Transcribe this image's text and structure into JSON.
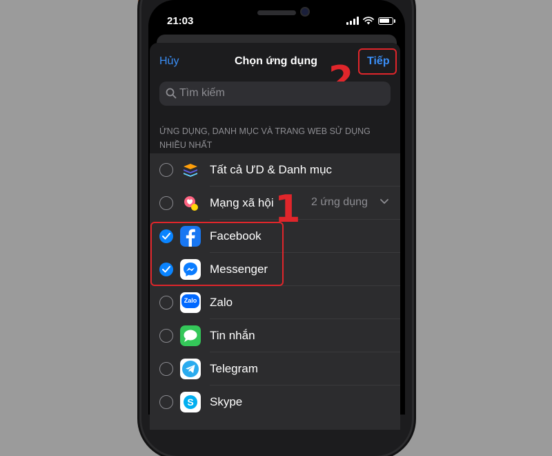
{
  "status_bar": {
    "time": "21:03"
  },
  "nav": {
    "cancel_label": "Hủy",
    "title": "Chọn ứng dụng",
    "next_label": "Tiếp"
  },
  "search": {
    "placeholder": "Tìm kiếm"
  },
  "section_header": "ỨNG DỤNG, DANH MỤC VÀ TRANG WEB SỬ DỤNG NHIỀU NHẤT",
  "rows": [
    {
      "label": "Tất cả ƯD & Danh mục",
      "selected": false,
      "icon": "stack-icon"
    },
    {
      "label": "Mạng xã hội",
      "detail": "2 ứng dụng",
      "selected": false,
      "icon": "social-icon"
    },
    {
      "label": "Facebook",
      "selected": true,
      "icon": "facebook-icon"
    },
    {
      "label": "Messenger",
      "selected": true,
      "icon": "messenger-icon"
    },
    {
      "label": "Zalo",
      "selected": false,
      "icon": "zalo-icon",
      "icon_text": "Zalo"
    },
    {
      "label": "Tin nhắn",
      "selected": false,
      "icon": "messages-icon"
    },
    {
      "label": "Telegram",
      "selected": false,
      "icon": "telegram-icon"
    },
    {
      "label": "Skype",
      "selected": false,
      "icon": "skype-icon"
    }
  ],
  "annotations": {
    "marker_1": "1",
    "marker_2": "2"
  },
  "colors": {
    "accent_blue": "#3a8ef6",
    "checkbox_blue": "#0a84ff",
    "annotation_red": "#e0262b",
    "sheet_bg": "#1c1c1e",
    "list_bg": "#2c2c2e"
  }
}
